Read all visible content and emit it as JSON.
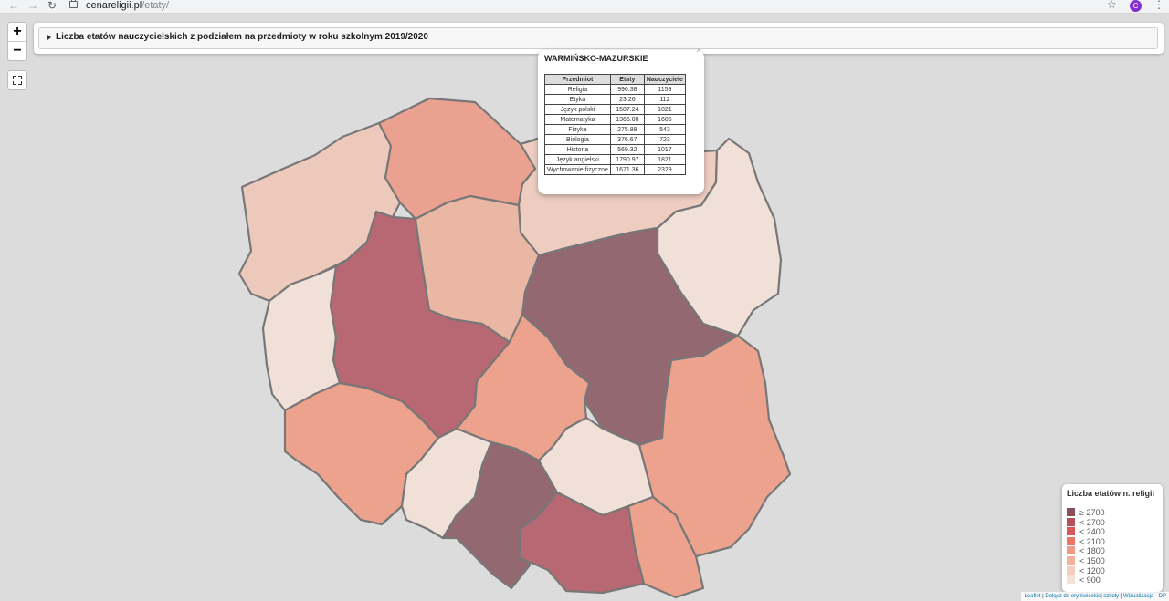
{
  "browser": {
    "url_domain": "cenareligii.pl",
    "url_path": "/etaty/",
    "avatar_letter": "C"
  },
  "controls": {
    "zoom_in": "+",
    "zoom_out": "−"
  },
  "header": {
    "title": "Liczba etatów nauczycielskich z podziałem na przedmioty w roku szkolnym 2019/2020"
  },
  "popup": {
    "close": "^",
    "region": "WARMIŃSKO-MAZURSKIE",
    "columns": [
      "Przedmiot",
      "Etaty",
      "Nauczyciele"
    ],
    "rows": [
      [
        "Religia",
        "996.38",
        "1159"
      ],
      [
        "Etyka",
        "23.26",
        "112"
      ],
      [
        "Język polski",
        "1587.24",
        "1821"
      ],
      [
        "Matematyka",
        "1366.08",
        "1605"
      ],
      [
        "Fizyka",
        "275.88",
        "543"
      ],
      [
        "Biologia",
        "376.67",
        "723"
      ],
      [
        "Historia",
        "569.32",
        "1017"
      ],
      [
        "Język angielski",
        "1790.97",
        "1821"
      ],
      [
        "Wychowanie fizyczne",
        "1671.36",
        "2329"
      ]
    ]
  },
  "legend": {
    "title": "Liczba etatów n. religii",
    "items": [
      {
        "label": "≥ 2700",
        "color": "#8b4f5a"
      },
      {
        "label": "< 2700",
        "color": "#b5505f"
      },
      {
        "label": "< 2400",
        "color": "#d9565a"
      },
      {
        "label": "< 2100",
        "color": "#ec7466"
      },
      {
        "label": "< 1800",
        "color": "#f09a85"
      },
      {
        "label": "< 1500",
        "color": "#f4b29d"
      },
      {
        "label": "< 1200",
        "color": "#f6ccbc"
      },
      {
        "label": "< 900",
        "color": "#f6e0d8"
      }
    ]
  },
  "attribution": {
    "leaflet": "Leaflet",
    "sep1": " | ",
    "link1": "Dołącz do ery świeckiej szkoły",
    "sep2": " | ",
    "link2": "Wizualizacja",
    "sep3": " · ",
    "link3": "DP"
  }
}
